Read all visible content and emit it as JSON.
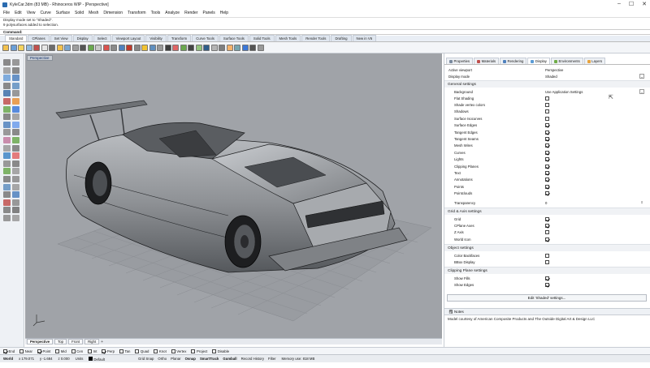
{
  "window": {
    "title": "KyleCar.3dm (83 MB) - Rhinoceros WIP - [Perspective]",
    "buttons": [
      "–",
      "☐",
      "✕"
    ]
  },
  "menu": [
    "File",
    "Edit",
    "View",
    "Curve",
    "Surface",
    "Solid",
    "Mesh",
    "Dimension",
    "Transform",
    "Tools",
    "Analyze",
    "Render",
    "Panels",
    "Help"
  ],
  "command_history": [
    "Display mode set to \"Shaded\".",
    "9 polysurfaces added to selection."
  ],
  "command_prompt": "Command:",
  "toolbar_tabs": [
    "Standard",
    "CPlanes",
    "Set View",
    "Display",
    "Select",
    "Viewport Layout",
    "Visibility",
    "Transform",
    "Curve Tools",
    "Surface Tools",
    "Solid Tools",
    "Mesh Tools",
    "Render Tools",
    "Drafting",
    "New in V6"
  ],
  "active_toolbar_tab": "Standard",
  "viewport": {
    "label": "Perspective",
    "tabs": [
      "Perspective",
      "Top",
      "Front",
      "Right"
    ],
    "active_tab": "Perspective",
    "add_tab": "+"
  },
  "osnaps": [
    {
      "label": "End",
      "checked": true
    },
    {
      "label": "Near",
      "checked": false
    },
    {
      "label": "Point",
      "checked": true
    },
    {
      "label": "Mid",
      "checked": false
    },
    {
      "label": "Cen",
      "checked": false
    },
    {
      "label": "Int",
      "checked": false
    },
    {
      "label": "Perp",
      "checked": true
    },
    {
      "label": "Tan",
      "checked": false
    },
    {
      "label": "Quad",
      "checked": false
    },
    {
      "label": "Knot",
      "checked": false
    },
    {
      "label": "Vertex",
      "checked": false
    },
    {
      "label": "Project",
      "checked": false
    },
    {
      "label": "Disable",
      "checked": false
    }
  ],
  "status": {
    "cplane": "World",
    "x": "x 179.071",
    "y": "y -1.684",
    "z": "z 0.000",
    "units": "Units",
    "layer": "Default",
    "toggles": [
      "Grid Snap",
      "Ortho",
      "Planar",
      "Osnap",
      "SmartTrack",
      "Gumball",
      "Record History",
      "Filter"
    ],
    "bold_toggles": [
      "Osnap",
      "SmartTrack",
      "Gumball"
    ],
    "memory": "Memory use: 818 MB"
  },
  "panel": {
    "tabs": [
      {
        "label": "Properties",
        "color": "#7a8a9e"
      },
      {
        "label": "Materials",
        "color": "#c0504d"
      },
      {
        "label": "Rendering",
        "color": "#4f81bd"
      },
      {
        "label": "Display",
        "color": "#5b9bd5"
      },
      {
        "label": "Environments",
        "color": "#70ad47"
      },
      {
        "label": "Layers",
        "color": "#e8a33d"
      }
    ],
    "active_tab": "Display",
    "active_viewport_label": "Active viewport",
    "active_viewport_value": "Perspective",
    "display_mode_label": "Display mode",
    "display_mode_value": "Shaded",
    "general_title": "General settings",
    "background_label": "Background",
    "background_value": "Use Application Settings",
    "general": [
      {
        "label": "Flat Shading",
        "checked": false
      },
      {
        "label": "Shade vertex colors",
        "checked": false
      },
      {
        "label": "Shadows",
        "checked": false
      },
      {
        "label": "Surface Isocurves",
        "checked": false
      },
      {
        "label": "Surface Edges",
        "checked": true
      },
      {
        "label": "Tangent Edges",
        "checked": true
      },
      {
        "label": "Tangent Seams",
        "checked": true
      },
      {
        "label": "Mesh Wires",
        "checked": true
      },
      {
        "label": "Curves",
        "checked": true
      },
      {
        "label": "Lights",
        "checked": true
      },
      {
        "label": "Clipping Planes",
        "checked": true
      },
      {
        "label": "Text",
        "checked": true
      },
      {
        "label": "Annotations",
        "checked": true
      },
      {
        "label": "Points",
        "checked": true
      },
      {
        "label": "Pointclouds",
        "checked": true
      }
    ],
    "transparency_label": "Transparency",
    "transparency_value": "0",
    "grid_title": "Grid & Axis settings",
    "grid": [
      {
        "label": "Grid",
        "checked": true
      },
      {
        "label": "CPlane Axes",
        "checked": true
      },
      {
        "label": "Z Axis",
        "checked": false
      },
      {
        "label": "World Icon",
        "checked": true
      }
    ],
    "object_title": "Object settings",
    "object": [
      {
        "label": "Color Backfaces",
        "checked": false
      },
      {
        "label": "BBox Display",
        "checked": false
      }
    ],
    "clip_title": "Clipping Plane settings",
    "clip": [
      {
        "label": "Show Fills",
        "checked": true
      },
      {
        "label": "Show Edges",
        "checked": true
      }
    ],
    "edit_button": "Edit 'Shaded' settings...",
    "notes_label": "Notes",
    "notes_text": "Model courtesy of American Composite Products and The Outside Digital Art & Design LLC"
  },
  "colors": {
    "viewport_bg": "#a0a3a8",
    "panel_header": "#f0f2f5"
  }
}
